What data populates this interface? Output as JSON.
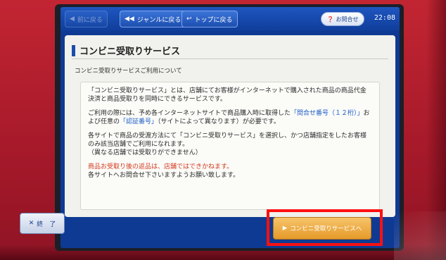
{
  "toolbar": {
    "back_label": "前に戻る",
    "genre_label": "ジャンルに戻る",
    "top_label": "トップに戻る",
    "inquiry_label": "お問合せ",
    "clock": "22:08"
  },
  "panel": {
    "title": "コンビニ受取りサービス",
    "subtitle": "コンビニ受取りサービスご利用について"
  },
  "content": {
    "para1": "「コンビニ受取りサービス」とは、店舗にてお客様がインターネットで購入された商品の商品代金決済と商品受取りを同時にできるサービスです。",
    "para2_a": "ご利用の際には、予め各インターネットサイトで商品購入時に取得した",
    "para2_hl1": "「問合せ番号（１２桁）」",
    "para2_b": "および任意の",
    "para2_hl2": "「認証番号」",
    "para2_c": "（サイトによって異なります）が必要です。",
    "para3_a": "各サイトで商品の受渡方法にて「コンビニ受取りサービス」を選択し、かつ店舗指定をしたお客様のみ該当店舗でご利用になれます。",
    "para3_b": "（異なる店舗では受取りができません）",
    "para4_red": "商品お受取り後の返品は、店舗ではできかねます。",
    "para4_b": "各サイトへお問合せ下さいますようお願い致します。"
  },
  "bottom": {
    "end_label": "終　了",
    "next_label": "コンビニ受取りサービスへ"
  },
  "colors": {
    "screen_blue": "#0e3a93",
    "highlight_red": "#ff1010",
    "next_button_orange": "#e69a2a",
    "link_blue": "#1e5fc8",
    "warning_red": "#d43a1f"
  }
}
